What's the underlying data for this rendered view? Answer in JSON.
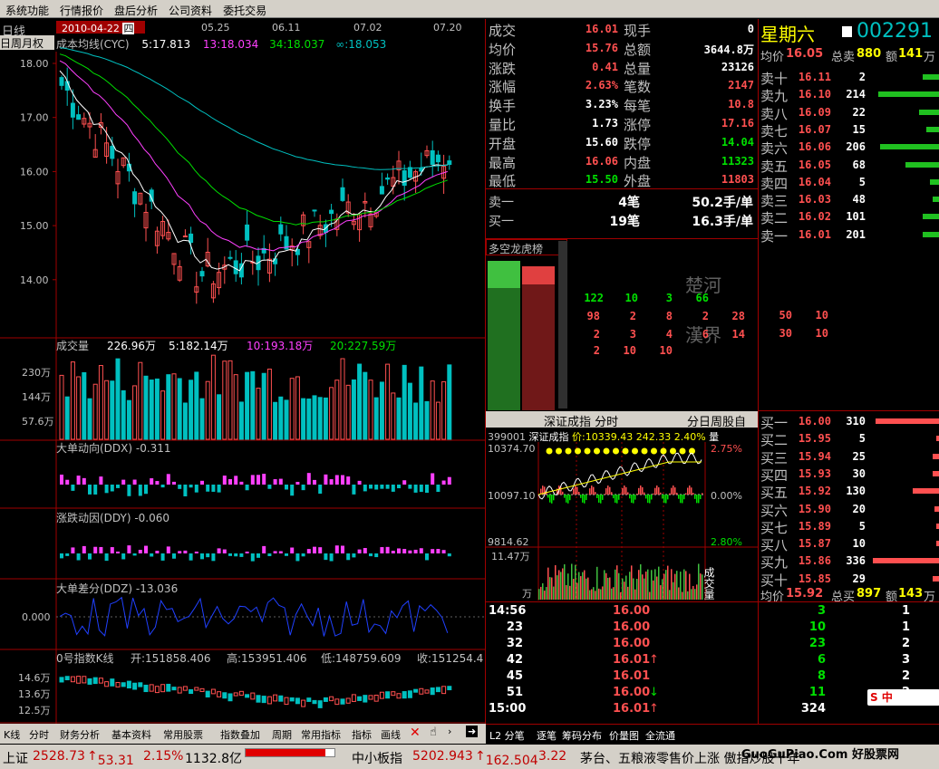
{
  "menu": [
    "系统功能",
    "行情报价",
    "盘后分析",
    "公司资料",
    "委托交易"
  ],
  "chart_header": {
    "period": "日线",
    "date": "2010-04-22",
    "weekday": "四",
    "period_tabs": "日周月权",
    "title": "成本均线(CYC)",
    "v5": "5:17.813",
    "v13": "13:18.034",
    "v34": "34:18.037",
    "vinf": "∞:18.053",
    "dates": [
      "05.25",
      "06.11",
      "07.02",
      "07.20"
    ]
  },
  "price_axis": [
    "18.00",
    "17.00",
    "16.00",
    "15.00",
    "14.00"
  ],
  "volume": {
    "title": "成交量",
    "total": "226.96万",
    "ma5": "5:182.14万",
    "ma10": "10:193.18万",
    "ma20": "20:227.59万",
    "axis": [
      "230万",
      "144万",
      "57.6万"
    ]
  },
  "ddx": {
    "title": "大单动向(DDX)",
    "value": "-0.311"
  },
  "ddy": {
    "title": "涨跌动因(DDY)",
    "value": "-0.060"
  },
  "ddz": {
    "title": "大单差分(DDZ)",
    "value": "-13.036",
    "axis": "0.000"
  },
  "index": {
    "title": "0号指数K线",
    "open": "开:151858.406",
    "high": "高:153951.406",
    "low": "低:148759.609",
    "close": "收:151254.4",
    "axis": [
      "14.6万",
      "13.6万",
      "12.5万"
    ]
  },
  "quote": {
    "rows": [
      {
        "l1": "成交",
        "v1": "16.01",
        "l2": "现手",
        "v2": "0",
        "c1": "red",
        "c2": "white"
      },
      {
        "l1": "均价",
        "v1": "15.76",
        "l2": "总额",
        "v2": "3644.8万",
        "c1": "red",
        "c2": "white"
      },
      {
        "l1": "涨跌",
        "v1": "0.41",
        "l2": "总量",
        "v2": "23126",
        "c1": "red",
        "c2": "white"
      },
      {
        "l1": "涨幅",
        "v1": "2.63%",
        "l2": "笔数",
        "v2": "2147",
        "c1": "red",
        "c2": "red"
      },
      {
        "l1": "换手",
        "v1": "3.23%",
        "l2": "每笔",
        "v2": "10.8",
        "c1": "white",
        "c2": "red"
      },
      {
        "l1": "量比",
        "v1": "1.73",
        "l2": "涨停",
        "v2": "17.16",
        "c1": "white",
        "c2": "red"
      },
      {
        "l1": "开盘",
        "v1": "15.60",
        "l2": "跌停",
        "v2": "14.04",
        "c1": "white",
        "c2": "green"
      },
      {
        "l1": "最高",
        "v1": "16.06",
        "l2": "内盘",
        "v2": "11323",
        "c1": "red",
        "c2": "green"
      },
      {
        "l1": "最低",
        "v1": "15.50",
        "l2": "外盘",
        "v2": "11803",
        "c1": "green",
        "c2": "red"
      }
    ],
    "sell1": {
      "label": "卖一",
      "count": "4笔",
      "avg": "50.2手/单"
    },
    "buy1": {
      "label": "买一",
      "count": "19笔",
      "avg": "16.3手/单"
    }
  },
  "stock": {
    "weekday": "星期六",
    "code": "002291"
  },
  "sell_header": {
    "l1": "均价",
    "v1": "16.05",
    "l2": "总卖",
    "v2": "880",
    "l3": "额",
    "v3": "141",
    "l4": "万"
  },
  "sells": [
    {
      "label": "卖十",
      "price": "16.11",
      "vol": "2",
      "bar": 0.25
    },
    {
      "label": "卖九",
      "price": "16.10",
      "vol": "214",
      "bar": 0.9
    },
    {
      "label": "卖八",
      "price": "16.09",
      "vol": "22",
      "bar": 0.3
    },
    {
      "label": "卖七",
      "price": "16.07",
      "vol": "15",
      "bar": 0.2
    },
    {
      "label": "卖六",
      "price": "16.06",
      "vol": "206",
      "bar": 0.88
    },
    {
      "label": "卖五",
      "price": "16.05",
      "vol": "68",
      "bar": 0.5
    },
    {
      "label": "卖四",
      "price": "16.04",
      "vol": "5",
      "bar": 0.15
    },
    {
      "label": "卖三",
      "price": "16.03",
      "vol": "48",
      "bar": 0.1
    },
    {
      "label": "卖二",
      "price": "16.02",
      "vol": "101",
      "bar": 0.25
    },
    {
      "label": "卖一",
      "price": "16.01",
      "vol": "201",
      "bar": 0.25
    }
  ],
  "buys": [
    {
      "label": "买一",
      "price": "16.00",
      "vol": "310",
      "bar": 0.95
    },
    {
      "label": "买二",
      "price": "15.95",
      "vol": "5",
      "bar": 0.05
    },
    {
      "label": "买三",
      "price": "15.94",
      "vol": "25",
      "bar": 0.1
    },
    {
      "label": "买四",
      "price": "15.93",
      "vol": "30",
      "bar": 0.1
    },
    {
      "label": "买五",
      "price": "15.92",
      "vol": "130",
      "bar": 0.4
    },
    {
      "label": "买六",
      "price": "15.90",
      "vol": "20",
      "bar": 0.08
    },
    {
      "label": "买七",
      "price": "15.89",
      "vol": "5",
      "bar": 0.05
    },
    {
      "label": "买八",
      "price": "15.87",
      "vol": "10",
      "bar": 0.05
    },
    {
      "label": "买九",
      "price": "15.86",
      "vol": "336",
      "bar": 0.98
    },
    {
      "label": "买十",
      "price": "15.85",
      "vol": "29",
      "bar": 0.1
    }
  ],
  "buy_footer": {
    "l1": "均价",
    "v1": "15.92",
    "l2": "总买",
    "v2": "897",
    "l3": "额",
    "v3": "143",
    "l4": "万"
  },
  "dragon": {
    "title": "多空龙虎榜",
    "row1": [
      "122",
      "10",
      "3",
      "66"
    ],
    "row2": [
      "98",
      "2",
      "8",
      "2",
      "28",
      "1",
      "50",
      "10"
    ],
    "row3": [
      "2",
      "3",
      "4",
      "6",
      "14",
      "20",
      "30",
      "10"
    ],
    "row4": [
      "2",
      "10",
      "10"
    ],
    "wm1": "楚河",
    "wm2": "漢界"
  },
  "intraday": {
    "title": "深证成指 分时",
    "tabs": "分日周股自",
    "code": "399001",
    "name": "深证成指",
    "price": "价:10339.43",
    "chg": "242.33",
    "pct": "2.40%",
    "qty": "量",
    "ylabels": [
      "10374.70",
      "10097.10",
      "9814.62"
    ],
    "pcts": [
      "2.75%",
      "0.00%",
      "2.80%"
    ],
    "vol_label": "11.47万",
    "vol_unit": "万",
    "side": "成交量"
  },
  "ticks": [
    {
      "t": "14:56",
      "p": "16.00",
      "arrow": "",
      "v": "3",
      "n": "1"
    },
    {
      "t": "23",
      "p": "16.00",
      "arrow": "",
      "v": "10",
      "n": "1"
    },
    {
      "t": "32",
      "p": "16.00",
      "arrow": "",
      "v": "23",
      "n": "2"
    },
    {
      "t": "42",
      "p": "16.01",
      "arrow": "↑",
      "v": "6",
      "n": "3"
    },
    {
      "t": "45",
      "p": "16.01",
      "arrow": "",
      "v": "8",
      "n": "2"
    },
    {
      "t": "51",
      "p": "16.00",
      "arrow": "↓",
      "v": "11",
      "n": "2"
    },
    {
      "t": "15:00",
      "p": "16.01",
      "arrow": "↑",
      "v": "324",
      "n": ""
    }
  ],
  "toolbar": [
    "K线",
    "分时",
    "财务分析",
    "基本资料",
    "常用股票",
    "指数叠加",
    "周期",
    "常用指标",
    "指标",
    "画线"
  ],
  "toolbar2": [
    "L2 分笔",
    "逐笔",
    "筹码分布",
    "价量图",
    "全流通"
  ],
  "status": {
    "sh_label": "上证",
    "sh_val": "2528.73",
    "sh_chg": "53.31",
    "sh_pct": "2.15%",
    "sh_amt": "1132.8亿",
    "zx_label": "中小板指",
    "zx_val": "5202.943",
    "zx_chg": "162.504",
    "zx_pct": "3.22",
    "news": "茅台、五粮液零售价上涨 傲指炒股十年",
    "watermark": "GuoGuPiao.Com 好股票网",
    "ime": "S 中"
  },
  "colors": {
    "up": "#ff5050",
    "down": "#00c0c0",
    "red_grid": "#a00000"
  }
}
